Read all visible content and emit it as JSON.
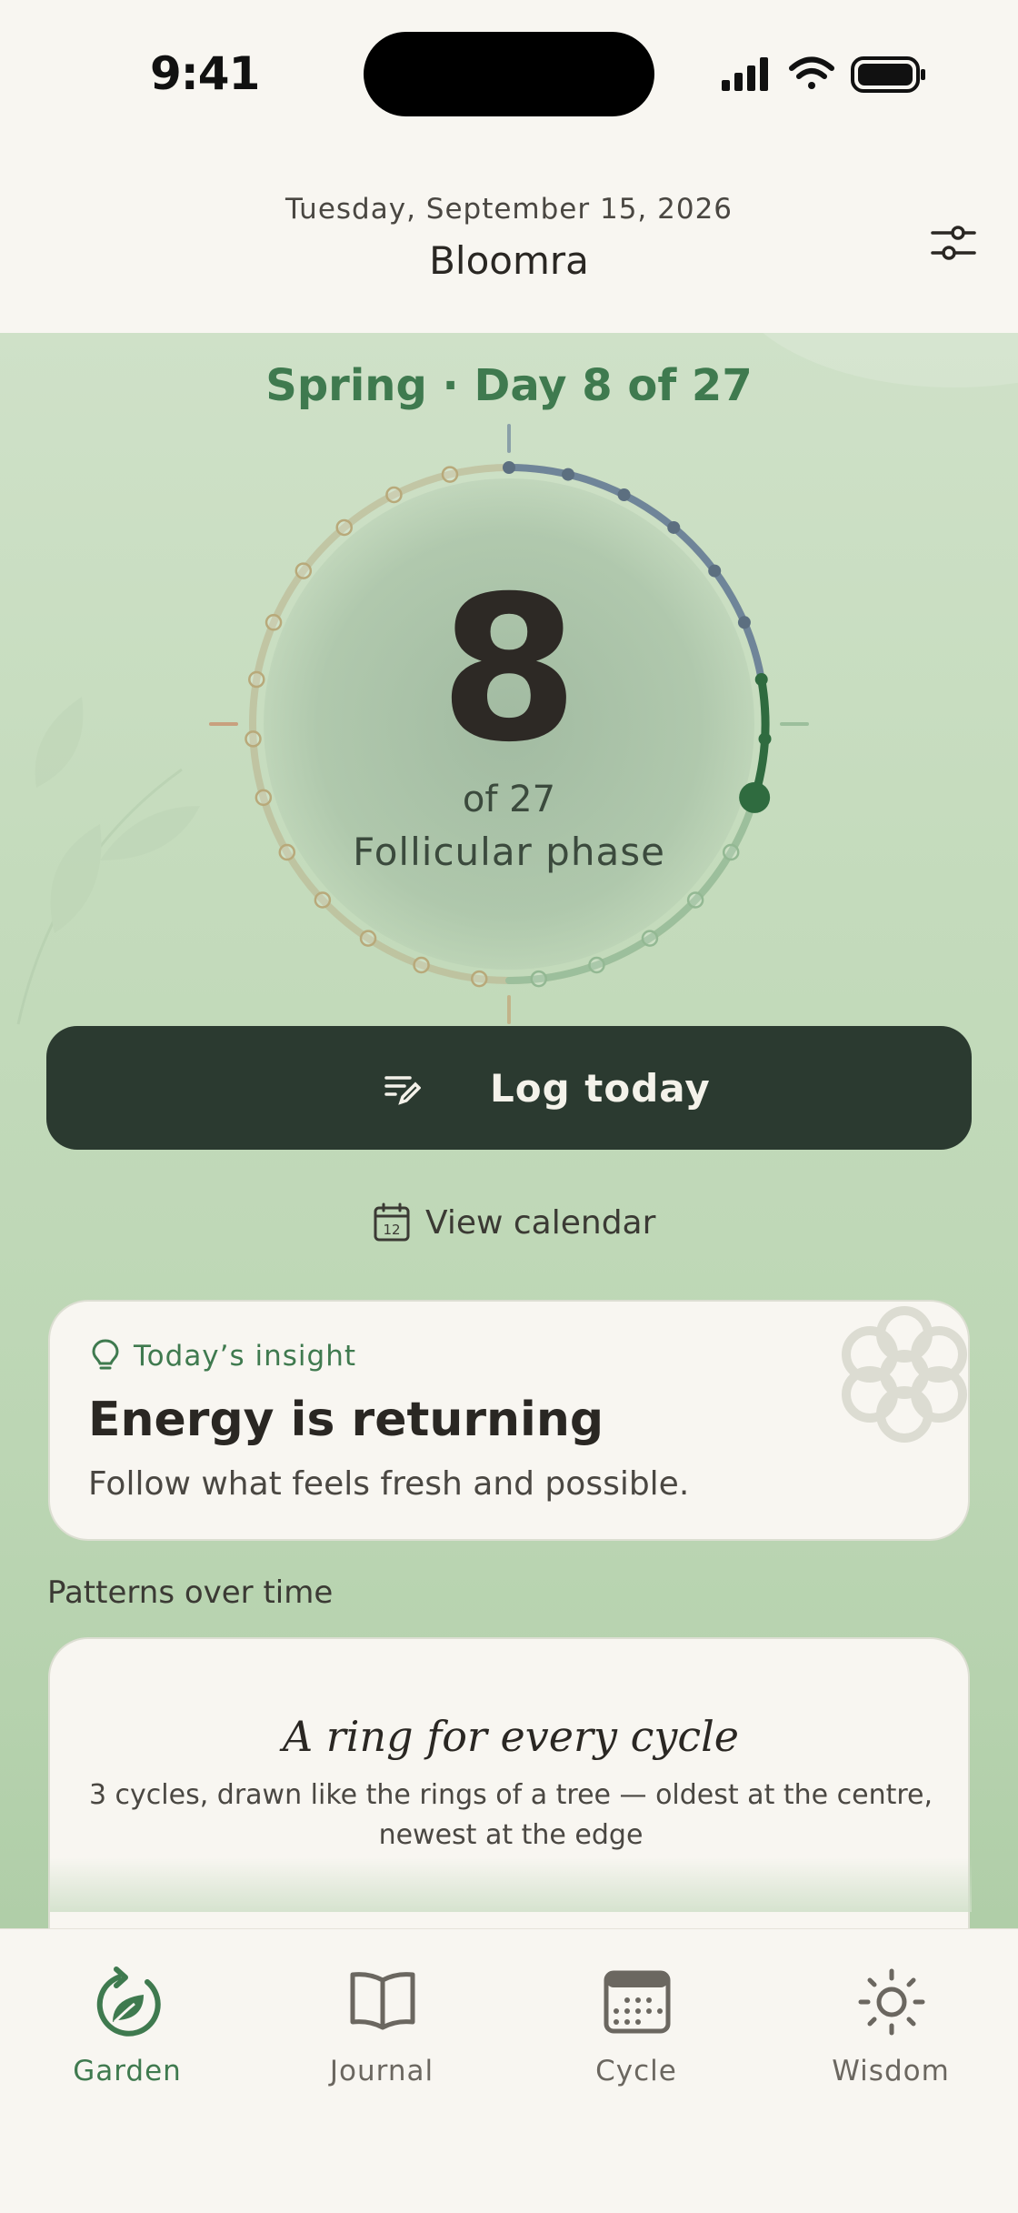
{
  "status_bar": {
    "time": "9:41"
  },
  "header": {
    "date": "Tuesday, September 15, 2026",
    "app_title": "Bloomra",
    "settings_icon": "sliders-icon"
  },
  "cycle": {
    "heading": "Spring · Day 8 of 27",
    "day_number": "8",
    "of_total": "of 27",
    "phase": "Follicular phase",
    "current_day": 8,
    "total_days": 27,
    "colors": {
      "past": "#6f8599",
      "today": "#2f6b3f",
      "future_spring": "#9cbf9c",
      "future_other": "#b9b08a",
      "accent": "#3f7a4f"
    }
  },
  "actions": {
    "log_label": "Log today",
    "log_icon": "edit-list-icon",
    "calendar_label": "View calendar",
    "calendar_icon": "calendar-icon",
    "calendar_icon_day": "12"
  },
  "insight": {
    "tag": "Today’s insight",
    "tag_icon": "lightbulb-icon",
    "title": "Energy is returning",
    "body": "Follow what feels fresh and possible."
  },
  "patterns": {
    "heading": "Patterns over time",
    "card_title": "A ring for every cycle",
    "card_subtitle": "3 cycles, drawn like the rings of a tree — oldest at the centre, newest at the edge"
  },
  "tabs": [
    {
      "label": "Garden",
      "icon": "leaf-cycle-icon",
      "active": true
    },
    {
      "label": "Journal",
      "icon": "book-icon",
      "active": false
    },
    {
      "label": "Cycle",
      "icon": "calendar-grid-icon",
      "active": false
    },
    {
      "label": "Wisdom",
      "icon": "sun-icon",
      "active": false
    }
  ]
}
